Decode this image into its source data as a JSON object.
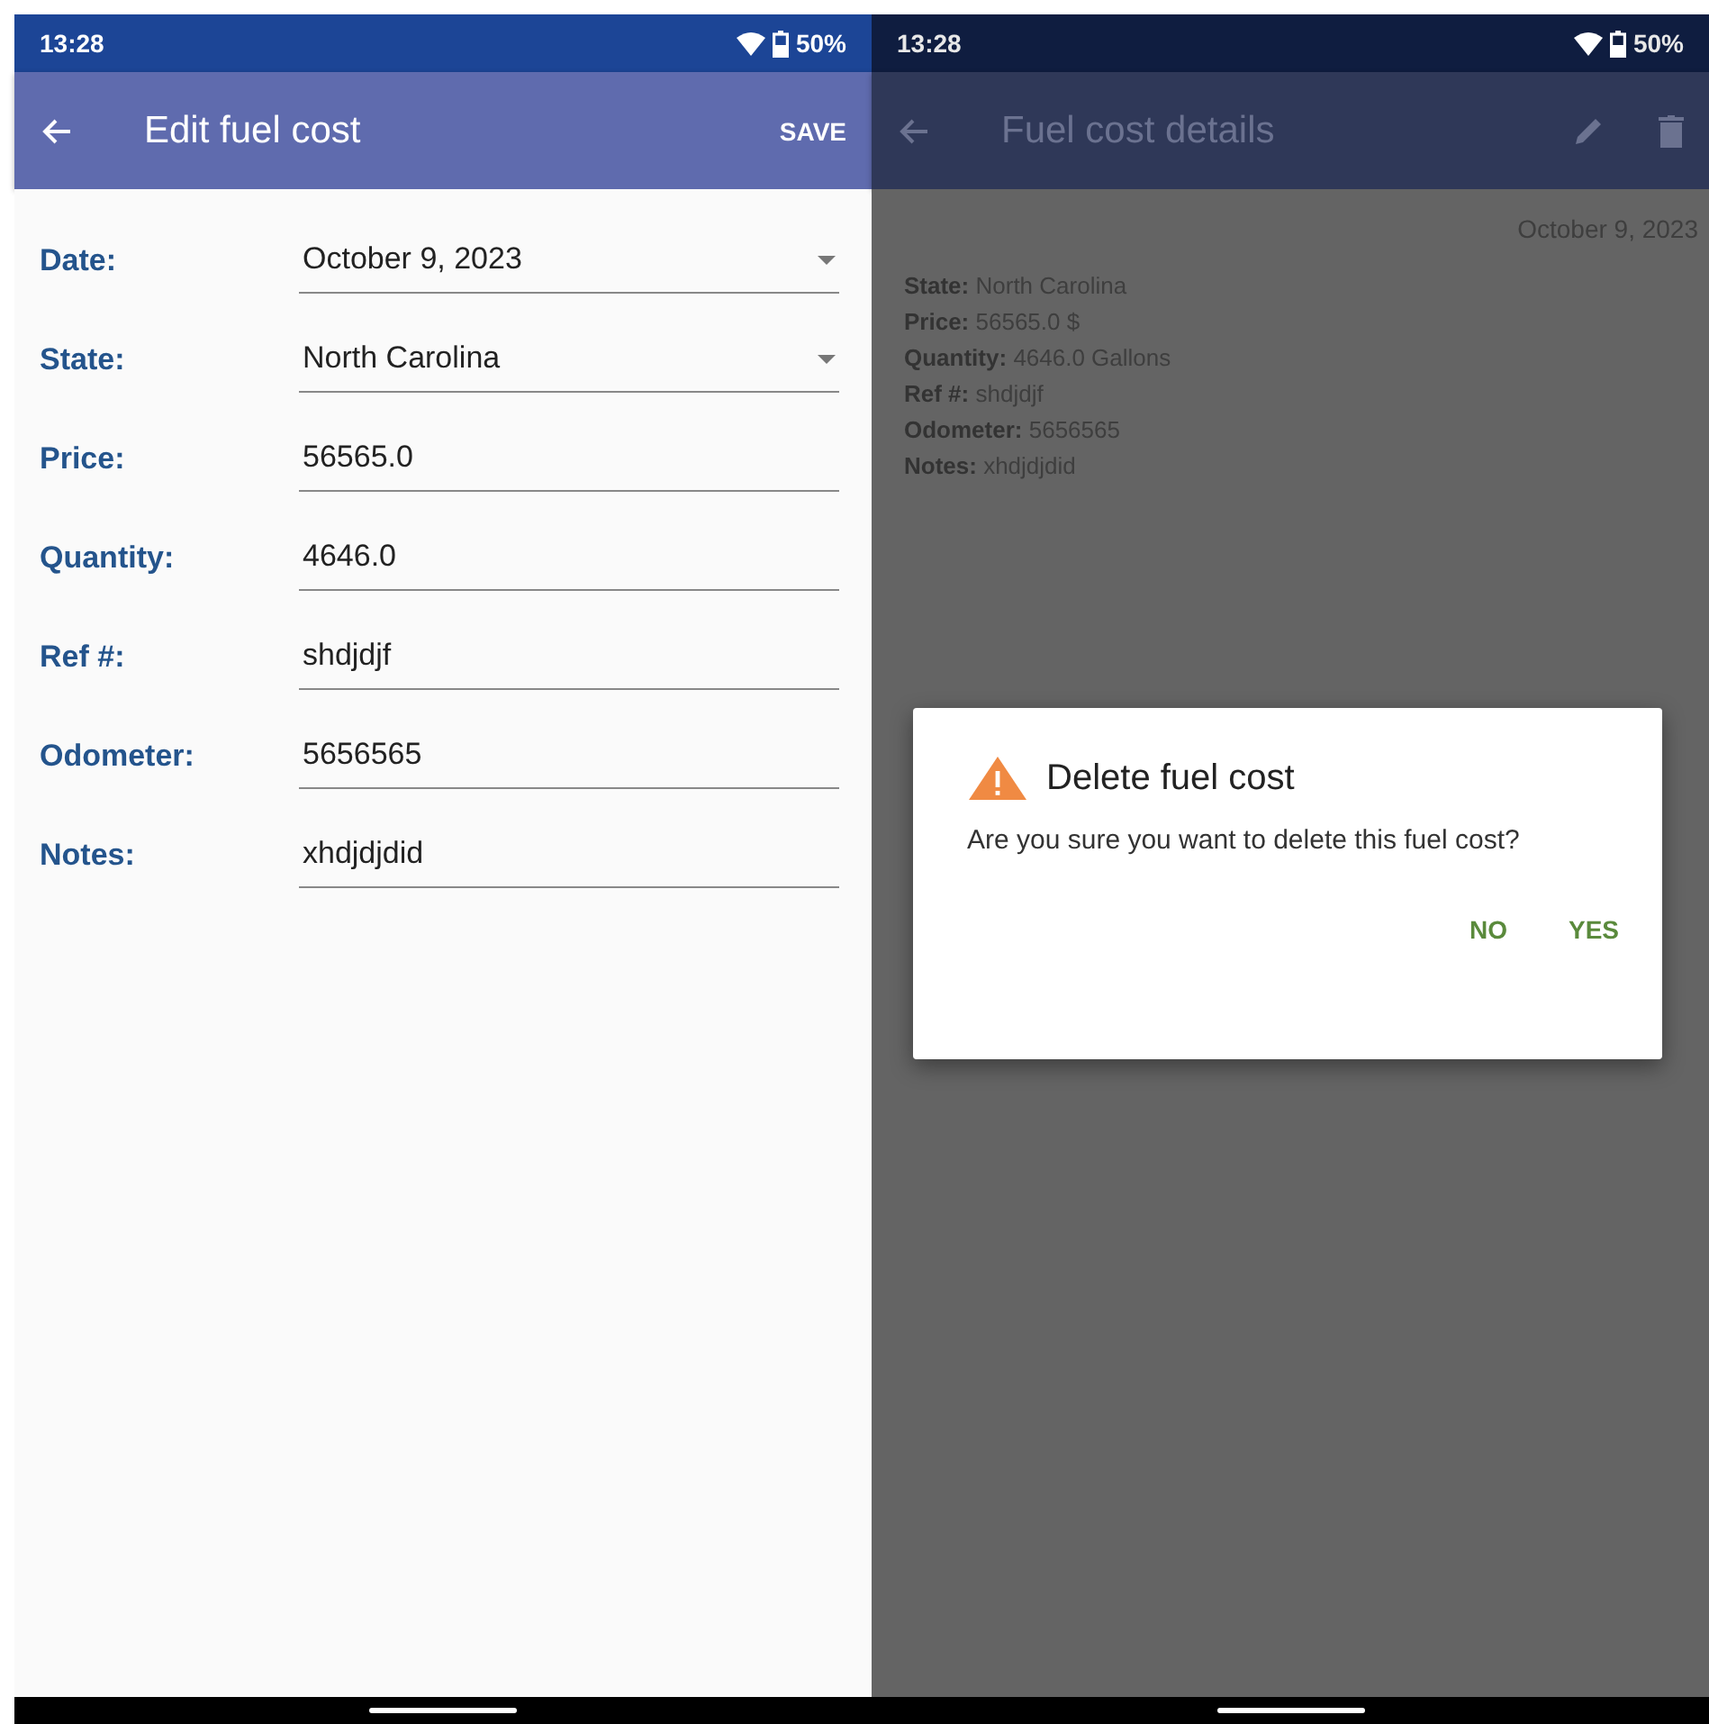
{
  "edit_screen": {
    "status_bar": {
      "time": "13:28",
      "battery": "50%"
    },
    "title": "Edit fuel cost",
    "action": "SAVE",
    "fields": [
      {
        "label": "Date:",
        "value": "October 9, 2023",
        "kind": "dropdown"
      },
      {
        "label": "State:",
        "value": "North Carolina",
        "kind": "dropdown"
      },
      {
        "label": "Price:",
        "value": "56565.0",
        "kind": "text"
      },
      {
        "label": "Quantity:",
        "value": "4646.0",
        "kind": "text"
      },
      {
        "label": "Ref #:",
        "value": "shdjdjf",
        "kind": "text"
      },
      {
        "label": "Odometer:",
        "value": "5656565",
        "kind": "text"
      },
      {
        "label": "Notes:",
        "value": "xhdjdjdid",
        "kind": "text"
      }
    ]
  },
  "details_screen": {
    "status_bar": {
      "time": "13:28",
      "battery": "50%"
    },
    "title": "Fuel cost details",
    "date": "October 9, 2023",
    "rows": [
      {
        "label": "State:",
        "value": "North Carolina"
      },
      {
        "label": "Price:",
        "value": "56565.0 $"
      },
      {
        "label": "Quantity:",
        "value": "4646.0 Gallons"
      },
      {
        "label": "Ref #:",
        "value": "shdjdjf"
      },
      {
        "label": "Odometer:",
        "value": "5656565"
      },
      {
        "label": "Notes:",
        "value": "xhdjdjdid"
      }
    ],
    "dialog": {
      "title": "Delete fuel cost",
      "message": "Are you sure you want to delete this fuel cost?",
      "buttons": [
        "NO",
        "YES"
      ]
    }
  }
}
